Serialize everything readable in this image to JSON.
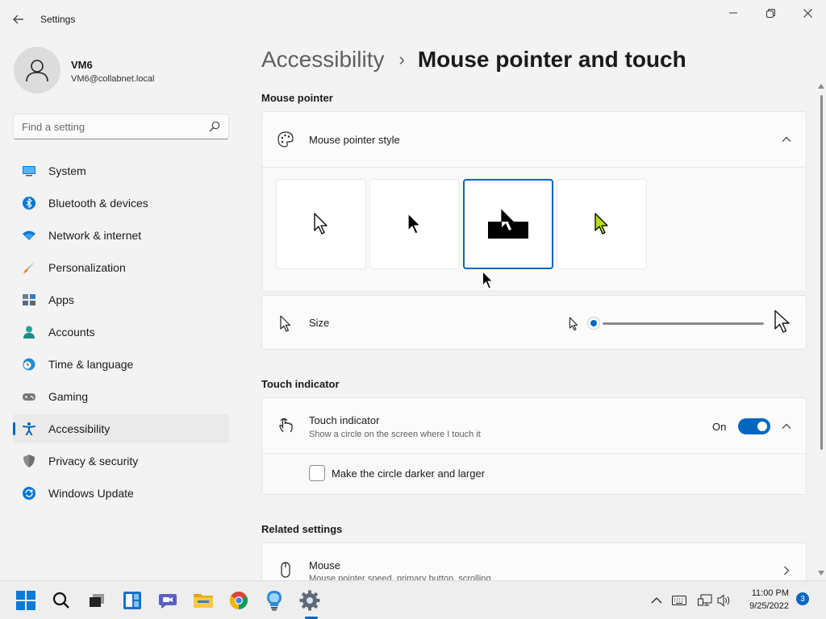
{
  "app": {
    "title": "Settings"
  },
  "profile": {
    "name": "VM6",
    "email": "VM6@collabnet.local"
  },
  "search": {
    "placeholder": "Find a setting"
  },
  "sidebar": {
    "items": [
      {
        "label": "System",
        "icon": "system-icon",
        "color": "#0078d4"
      },
      {
        "label": "Bluetooth & devices",
        "icon": "bluetooth-icon",
        "color": "#0078d4"
      },
      {
        "label": "Network & internet",
        "icon": "wifi-icon",
        "color": "#0078d4"
      },
      {
        "label": "Personalization",
        "icon": "brush-icon",
        "color": "#e8912d"
      },
      {
        "label": "Apps",
        "icon": "apps-icon",
        "color": "#5b6b7a"
      },
      {
        "label": "Accounts",
        "icon": "accounts-icon",
        "color": "#2aa198"
      },
      {
        "label": "Time & language",
        "icon": "clock-globe-icon",
        "color": "#0078d4"
      },
      {
        "label": "Gaming",
        "icon": "gamepad-icon",
        "color": "#7a7a7a"
      },
      {
        "label": "Accessibility",
        "icon": "accessibility-icon",
        "color": "#0067c0",
        "active": true
      },
      {
        "label": "Privacy & security",
        "icon": "shield-icon",
        "color": "#7a7a7a"
      },
      {
        "label": "Windows Update",
        "icon": "update-icon",
        "color": "#0078d4"
      }
    ]
  },
  "breadcrumb": {
    "parent": "Accessibility",
    "separator": "›",
    "current": "Mouse pointer and touch"
  },
  "mouse_pointer": {
    "section_title": "Mouse pointer",
    "style_row": {
      "label": "Mouse pointer style",
      "icon": "palette-icon",
      "expanded": true
    },
    "styles": [
      {
        "name": "white-pointer",
        "selected": false
      },
      {
        "name": "black-pointer",
        "selected": false
      },
      {
        "name": "inverted-pointer",
        "selected": true
      },
      {
        "name": "custom-color-pointer",
        "selected": false,
        "color": "#b4e00b"
      }
    ],
    "size_row": {
      "label": "Size",
      "icon": "pointer-icon",
      "value": 1,
      "min": 1,
      "max": 15
    }
  },
  "touch_indicator": {
    "section_title": "Touch indicator",
    "row": {
      "label": "Touch indicator",
      "description": "Show a circle on the screen where I touch it",
      "toggle_label": "On",
      "toggle_on": true,
      "icon": "touch-icon"
    },
    "option": {
      "label": "Make the circle darker and larger",
      "checked": false
    }
  },
  "related": {
    "section_title": "Related settings",
    "mouse_row": {
      "label": "Mouse",
      "description": "Mouse pointer speed, primary button, scrolling",
      "icon": "mouse-icon"
    }
  },
  "taskbar": {
    "apps": [
      "windows-start-icon",
      "search-icon",
      "task-view-icon",
      "widgets-icon",
      "chat-icon",
      "file-explorer-icon",
      "chrome-icon",
      "lightbulb-icon",
      "settings-icon"
    ],
    "time": "11:00 PM",
    "date": "9/25/2022",
    "notifications": "3"
  },
  "colors": {
    "accent": "#0067c0",
    "background": "#f3f3f3",
    "card": "#fbfbfb"
  }
}
